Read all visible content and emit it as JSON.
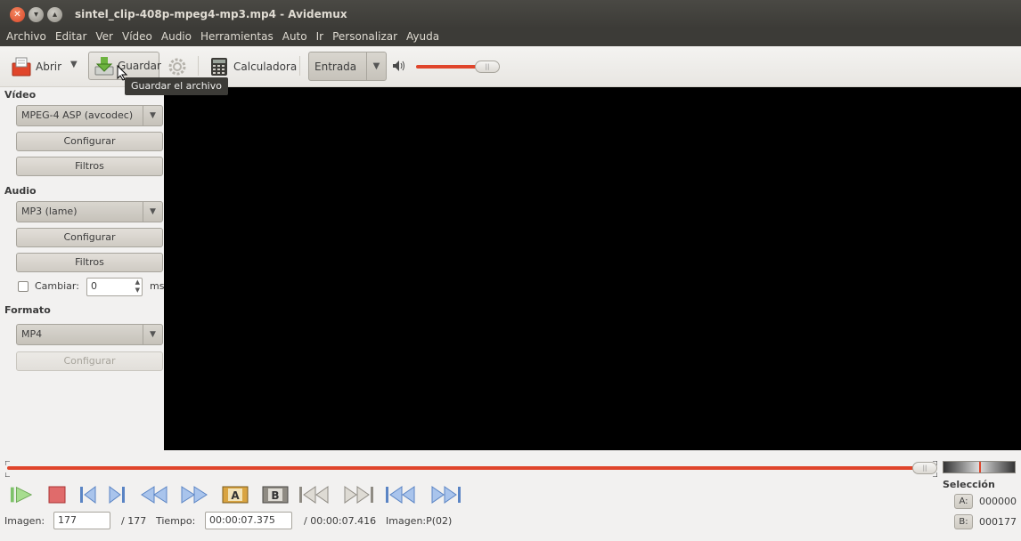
{
  "window": {
    "title": "sintel_clip-408p-mpeg4-mp3.mp4 - Avidemux",
    "buttons": [
      "close-icon",
      "minimize-icon",
      "maximize-icon"
    ]
  },
  "menu": [
    "Archivo",
    "Editar",
    "Ver",
    "Vídeo",
    "Audio",
    "Herramientas",
    "Auto",
    "Ir",
    "Personalizar",
    "Ayuda"
  ],
  "toolbar": {
    "open_label": "Abrir",
    "save_label": "Guardar",
    "calculator_label": "Calculadora",
    "input_combo_value": "Entrada",
    "tooltip": "Guardar el archivo",
    "volume_fraction": 0.85
  },
  "video_section": {
    "title": "Vídeo",
    "codec": "MPEG-4 ASP (avcodec)",
    "configure_label": "Configurar",
    "filters_label": "Filtros"
  },
  "audio_section": {
    "title": "Audio",
    "codec": "MP3 (lame)",
    "configure_label": "Configurar",
    "filters_label": "Filtros",
    "shift_label": "Cambiar:",
    "shift_value": "0",
    "shift_unit": "ms"
  },
  "format_section": {
    "title": "Formato",
    "container": "MP4",
    "configure_label": "Configurar"
  },
  "status": {
    "frame_label": "Imagen:",
    "frame_value": "177",
    "frame_total": "/ 177",
    "time_label": "Tiempo:",
    "time_value": "00:00:07.375",
    "time_total": "/ 00:00:07.416",
    "frame_type": "Imagen:P(02)",
    "timeline_position": 0.985
  },
  "selection": {
    "title": "Selección",
    "a_label": "A:",
    "a_value": "000000",
    "b_label": "B:",
    "b_value": "000177"
  },
  "colors": {
    "accent_red": "#e0452b",
    "menu_bg": "#3c3b37",
    "transport_blue": "#5a84c4"
  }
}
